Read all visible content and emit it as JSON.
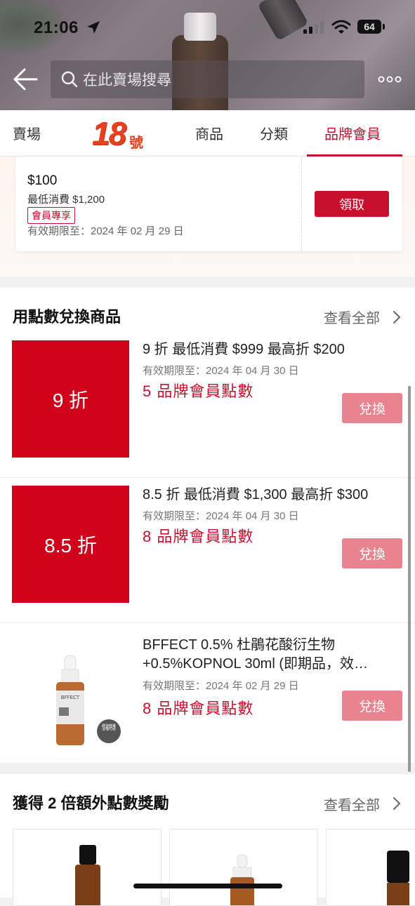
{
  "status_bar": {
    "time": "21:06",
    "battery": "64"
  },
  "header": {
    "search_placeholder": "在此賣場搜尋"
  },
  "tabs": {
    "store": "賣場",
    "logo_number": "18",
    "logo_suffix": "號",
    "products": "商品",
    "category": "分類",
    "member": "品牌會員",
    "active": "member"
  },
  "voucher": {
    "amount": "$100",
    "min_spend": "最低消費 $1,200",
    "badge": "會員專享",
    "expiry": "有效期限至：2024 年 02 月 29 日",
    "claim_label": "領取"
  },
  "points_section": {
    "title": "用點數兌換商品",
    "view_all": "查看全部",
    "items": [
      {
        "image_text": "9 折",
        "title": "9 折 最低消費 $999 最高折 $200",
        "expiry": "有效期限至：2024 年 04 月 30 日",
        "points": "5 品牌會員點數",
        "button": "兌換"
      },
      {
        "image_text": "8.5 折",
        "title": "8.5 折 最低消費 $1,300 最高折 $300",
        "expiry": "有效期限至：2024 年 04 月 30 日",
        "points": "8 品牌會員點數",
        "button": "兌換"
      },
      {
        "title": "BFFECT 0.5% 杜鵑花酸衍生物 +0.5%KOPNOL 30ml (即期品，效…",
        "expiry": "有效期限至：2024 年 02 月 29 日",
        "points": "8 品牌會員點數",
        "button": "兌換",
        "product_brand": "BFFECT",
        "product_badge": "惜福特惠"
      }
    ]
  },
  "bonus_section": {
    "title": "獲得 2 倍額外點數獎勵",
    "view_all": "查看全部"
  },
  "colors": {
    "accent": "#c8102e",
    "logo": "#e8401c",
    "redeem_button": "#e9838f"
  }
}
